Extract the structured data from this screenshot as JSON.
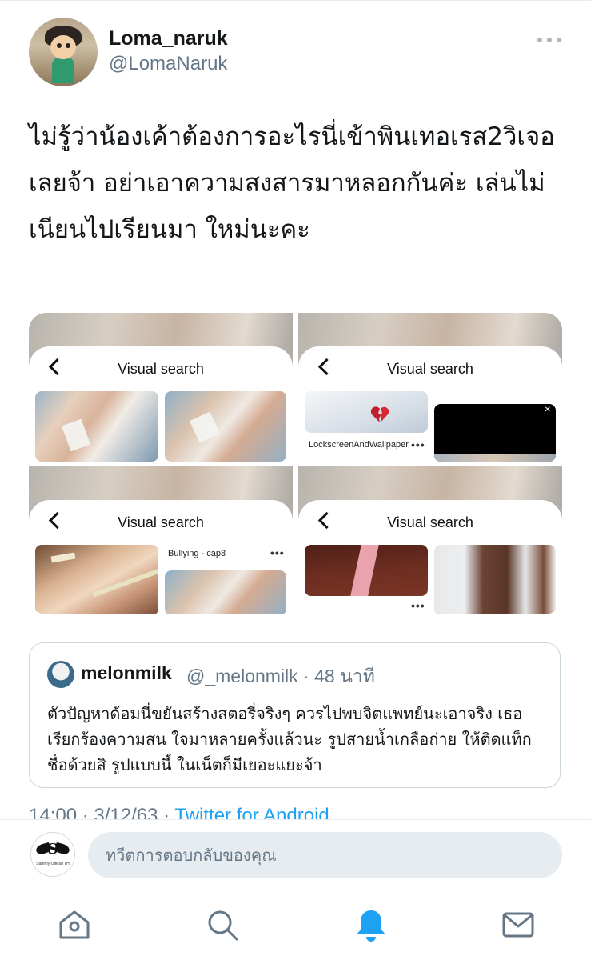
{
  "tweet": {
    "author_name": "Loma_naruk",
    "author_handle": "@LomaNaruk",
    "text": "ไม่รู้ว่าน้องเค้าต้องการอะไรนี่เข้าพินเทอเรส2วิเจอเลยจ้า อย่าเอาความสงสารมาหลอกกันค่ะ เล่นไม่เนียนไปเรียนมา ใหม่นะคะ",
    "timestamp": "14:00 · 3/12/63 · ",
    "via": "Twitter for Android"
  },
  "media": {
    "screens": [
      {
        "header": "Visual search"
      },
      {
        "header": "Visual search",
        "pin_label": "LockscreenAndWallpaper",
        "pin_dots": "•••"
      },
      {
        "header": "Visual search",
        "pin_label": "Bullying - cap8",
        "pin_dots": "•••"
      },
      {
        "header": "Visual search",
        "pin_dots": "•••"
      }
    ]
  },
  "quote": {
    "name": "melonmilk",
    "meta": "@_melonmilk · 48 นาที",
    "text": "ตัวปัญหาด้อมนี่ขยันสร้างสตอรี่จริงๆ ควรไปพบจิตแพทย์นะเอาจริง เธอเรียกร้องความสน ใจมาหลายครั้งแล้วนะ รูปสายน้ำเกลือถ่าย ให้ติดแท็กชื่อด้วยสิ รูปแบบนี้ ในเน็ตก็มีเยอะแยะจ้า"
  },
  "reply": {
    "placeholder": "ทวีตการตอบกลับของคุณ",
    "avatar_text": "S",
    "avatar_caption": "Sammy Official TH"
  },
  "nav": {
    "items": [
      {
        "icon": "home-icon"
      },
      {
        "icon": "search-icon"
      },
      {
        "icon": "notifications-icon",
        "active": true
      },
      {
        "icon": "messages-icon"
      }
    ],
    "active_color": "#1da1f2",
    "inactive_color": "#657786"
  }
}
